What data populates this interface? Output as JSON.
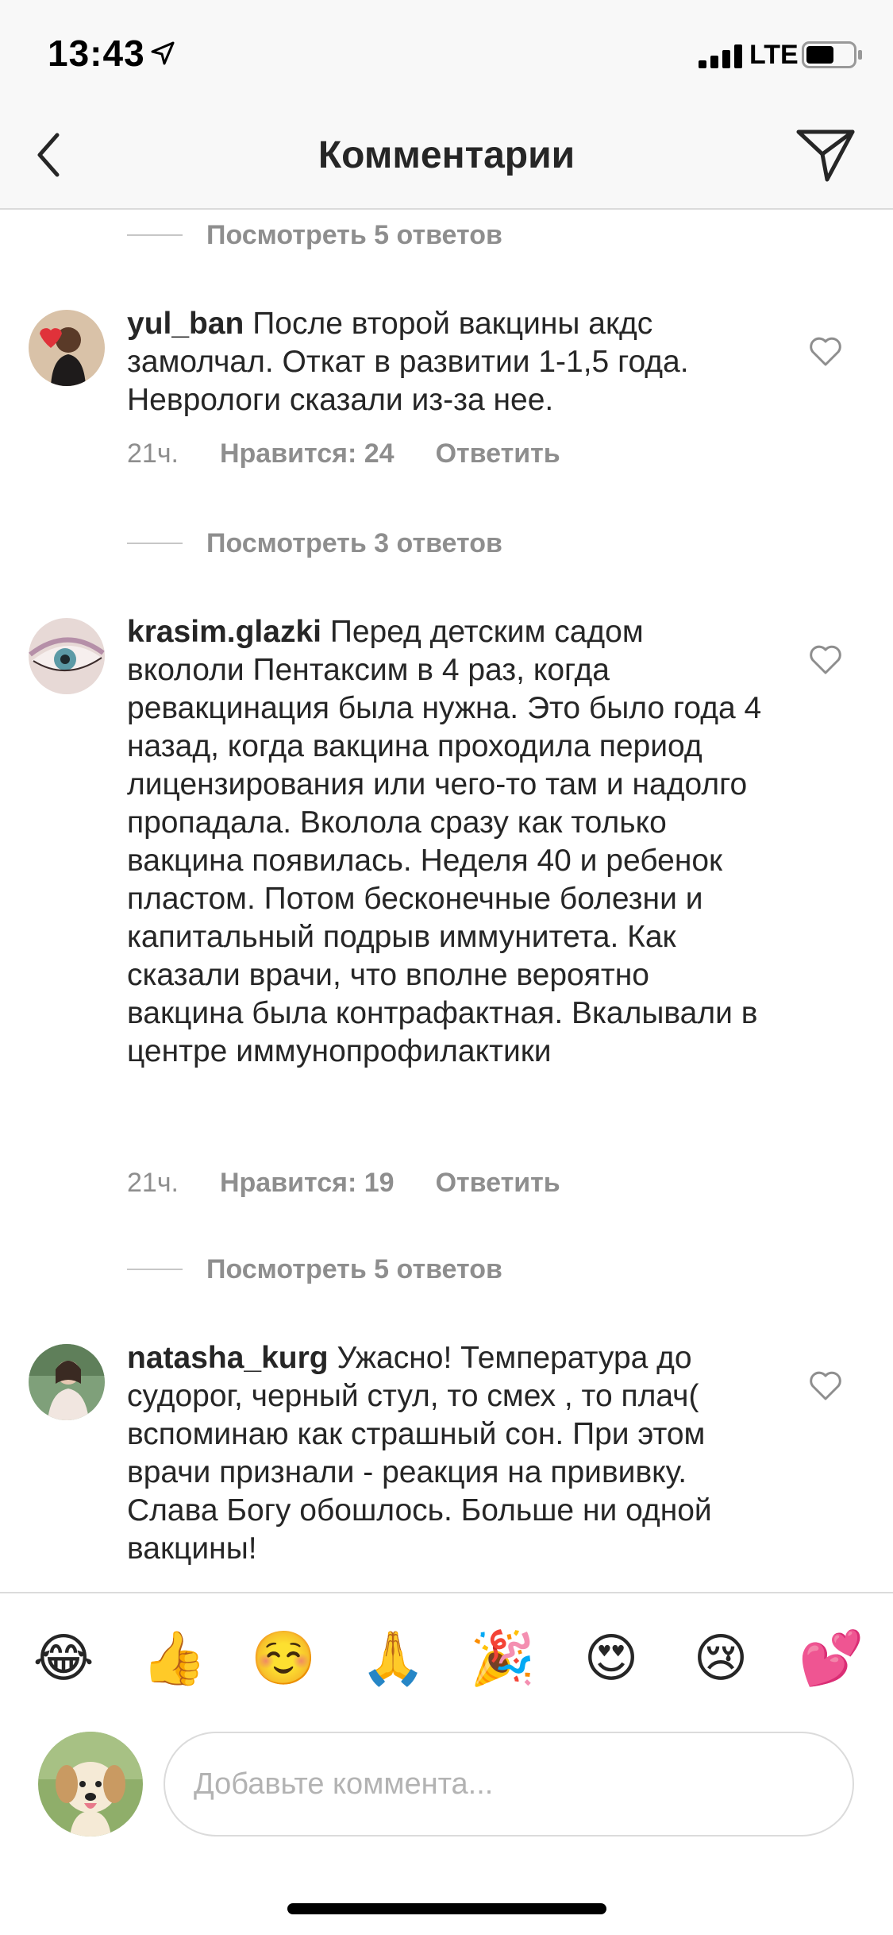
{
  "status_bar": {
    "time": "13:43",
    "network": "LTE"
  },
  "nav": {
    "title": "Комментарии"
  },
  "comments": [
    {
      "view_replies": "Посмотреть 5 ответов"
    },
    {
      "username": "yul_ban",
      "text": "После второй вакцины акдс замолчал. Откат в развитии 1-1,5 года. Неврологи сказали из-за нее.",
      "time": "21ч.",
      "likes": "Нравится: 24",
      "reply": "Ответить",
      "view_replies": "Посмотреть 3 ответов"
    },
    {
      "username": "krasim.glazki",
      "text": "Перед детским садом вкололи Пентаксим в 4 раз, когда ревакцинация была нужна. Это было года 4 назад, когда вакцина проходила период лицензирования или чего-то там и надолго пропадала. Вколола сразу как только вакцина появилась. Неделя 40 и ребенок пластом. Потом бесконечные болезни и капитальный подрыв иммунитета. Как сказали врачи, что вполне вероятно вакцина была контрафактная. Вкалывали в центре иммунопрофилактики",
      "time": "21ч.",
      "likes": "Нравится: 19",
      "reply": "Ответить",
      "view_replies": "Посмотреть 5 ответов"
    },
    {
      "username": "natasha_kurg",
      "text": "Ужасно! Температура до судорог, черный стул, то смех , то плач( вспоминаю как страшный сон. При этом врачи признали - реакция на прививку. Слава Богу обошлось. Больше ни одной вакцины!"
    }
  ],
  "emoji_bar": [
    "😂",
    "👍",
    "☺️",
    "🙏",
    "🎉",
    "😍",
    "😢",
    "💕"
  ],
  "input": {
    "placeholder": "Добавьте коммента..."
  }
}
